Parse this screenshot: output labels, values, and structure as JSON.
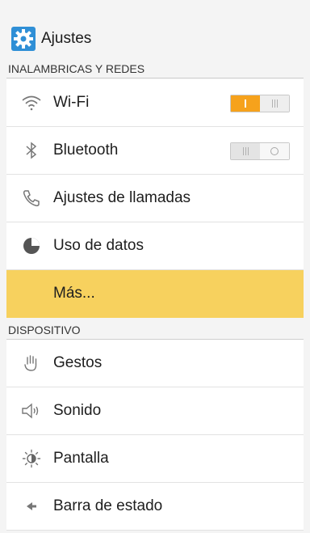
{
  "header": {
    "title": "Ajustes",
    "icon": "gear-icon",
    "icon_color": "#2f8fd6"
  },
  "sections": {
    "wireless": {
      "title": "INALAMBRICAS Y REDES",
      "items": [
        {
          "label": "Wi-Fi",
          "icon": "wifi-icon",
          "toggle": "on"
        },
        {
          "label": "Bluetooth",
          "icon": "bluetooth-icon",
          "toggle": "off"
        },
        {
          "label": "Ajustes de llamadas",
          "icon": "phone-icon"
        },
        {
          "label": "Uso de datos",
          "icon": "data-usage-icon"
        },
        {
          "label": "Más...",
          "highlighted": true
        }
      ]
    },
    "device": {
      "title": "DISPOSITIVO",
      "items": [
        {
          "label": "Gestos",
          "icon": "hand-gesture-icon"
        },
        {
          "label": "Sonido",
          "icon": "speaker-icon"
        },
        {
          "label": "Pantalla",
          "icon": "brightness-icon"
        },
        {
          "label": "Barra de estado",
          "icon": "status-bar-icon"
        }
      ]
    }
  },
  "colors": {
    "toggle_on": "#f6a21c",
    "highlight": "#f7d15e",
    "background": "#f4f4f4"
  }
}
